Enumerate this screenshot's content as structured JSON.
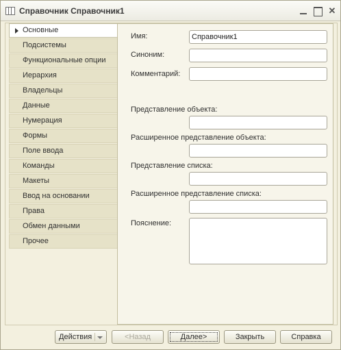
{
  "window": {
    "title": "Справочник Справочник1",
    "minimize_icon": "minimize-icon",
    "maximize_icon": "maximize-icon",
    "close_glyph": "✕"
  },
  "sidebar": {
    "items": [
      {
        "label": "Основные",
        "active": true
      },
      {
        "label": "Подсистемы",
        "active": false
      },
      {
        "label": "Функциональные опции",
        "active": false
      },
      {
        "label": "Иерархия",
        "active": false
      },
      {
        "label": "Владельцы",
        "active": false
      },
      {
        "label": "Данные",
        "active": false
      },
      {
        "label": "Нумерация",
        "active": false
      },
      {
        "label": "Формы",
        "active": false
      },
      {
        "label": "Поле ввода",
        "active": false
      },
      {
        "label": "Команды",
        "active": false
      },
      {
        "label": "Макеты",
        "active": false
      },
      {
        "label": "Ввод на основании",
        "active": false
      },
      {
        "label": "Права",
        "active": false
      },
      {
        "label": "Обмен данными",
        "active": false
      },
      {
        "label": "Прочее",
        "active": false
      }
    ]
  },
  "form": {
    "name": {
      "label": "Имя:",
      "value": "Справочник1"
    },
    "synonym": {
      "label": "Синоним:",
      "value": ""
    },
    "comment": {
      "label": "Комментарий:",
      "value": ""
    },
    "object_presentation": {
      "label": "Представление объекта:",
      "value": ""
    },
    "extended_object_presentation": {
      "label": "Расширенное представление объекта:",
      "value": ""
    },
    "list_presentation": {
      "label": "Представление списка:",
      "value": ""
    },
    "extended_list_presentation": {
      "label": "Расширенное представление списка:",
      "value": ""
    },
    "explanation": {
      "label": "Пояснение:",
      "value": ""
    }
  },
  "footer": {
    "actions_label": "Действия",
    "back_label": "<Назад",
    "next_label": "Далее>",
    "close_label": "Закрыть",
    "help_label": "Справка"
  },
  "colors": {
    "window_bg": "#f3f0df",
    "tab_bg": "#e6e2c8",
    "content_bg": "#f7f5ea"
  }
}
